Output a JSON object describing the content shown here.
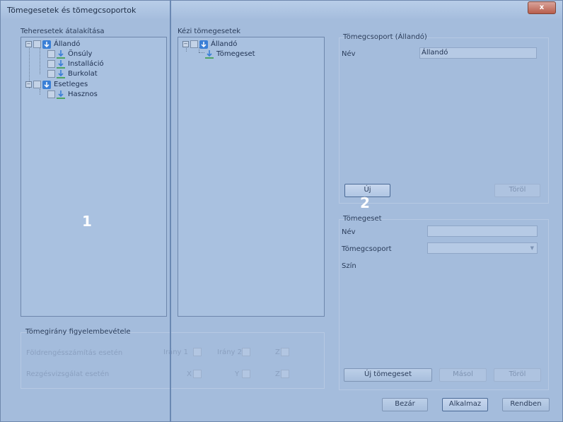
{
  "window": {
    "title": "Tömegesetek és tömegcsoportok",
    "close_label": "x"
  },
  "left_panel": {
    "title": "Teheresetek átalakítása",
    "tree": [
      {
        "label": "Állandó",
        "expander": "−"
      },
      {
        "label": "Önsúly"
      },
      {
        "label": "Installáció"
      },
      {
        "label": "Burkolat"
      },
      {
        "label": "Esetleges",
        "expander": "−"
      },
      {
        "label": "Hasznos"
      }
    ]
  },
  "middle_panel": {
    "title": "Kézi tömegesetek",
    "tree": [
      {
        "label": "Állandó",
        "expander": "−"
      },
      {
        "label": "Tömegeset"
      }
    ]
  },
  "group_panel": {
    "title": "Tömegcsoport (Állandó)",
    "name_label": "Név",
    "name_value": "Állandó",
    "new_button": "Új",
    "delete_button": "Töröl"
  },
  "case_panel": {
    "title": "Tömegeset",
    "name_label": "Név",
    "name_value": "",
    "group_label": "Tömegcsoport",
    "group_value": "",
    "color_label": "Szín",
    "new_case_button": "Új tömegeset",
    "copy_button": "Másol",
    "delete_button": "Töröl"
  },
  "direction": {
    "title": "Tömegirány figyelembevétele",
    "row1": {
      "label": "Földrengésszámítás esetén",
      "opt1": "Irány 1",
      "opt2": "Irány 2",
      "opt3": "Z"
    },
    "row2": {
      "label": "Rezgésvizsgálat esetén",
      "opt1": "X",
      "opt2": "Y",
      "opt3": "Z"
    }
  },
  "footer": {
    "close_button": "Bezár",
    "apply_button": "Alkalmaz",
    "ok_button": "Rendben"
  },
  "markers": {
    "one": "1",
    "two": "2"
  },
  "colors": {
    "window_bg": "#a4bcdc",
    "icon_blue": "#3a7fd6",
    "icon_green": "#2f9a3a"
  }
}
